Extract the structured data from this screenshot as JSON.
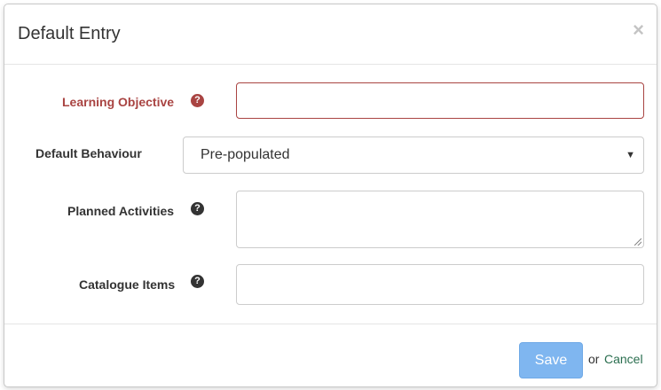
{
  "modal": {
    "title": "Default Entry",
    "close_glyph": "×"
  },
  "form": {
    "learning_objective": {
      "label": "Learning Objective",
      "value": "",
      "state": "error",
      "help_icon": "question-circle-icon"
    },
    "default_behaviour": {
      "label": "Default Behaviour",
      "selected": "Pre-populated"
    },
    "planned_activities": {
      "label": "Planned Activities",
      "value": "",
      "help_icon": "question-circle-icon"
    },
    "catalogue_items": {
      "label": "Catalogue Items",
      "value": "",
      "help_icon": "question-circle-icon"
    }
  },
  "footer": {
    "save_label": "Save",
    "or_text": "or",
    "cancel_label": "Cancel"
  },
  "colors": {
    "error": "#a94442",
    "primary_disabled": "#7fb6f0",
    "link": "#2a6e4f"
  }
}
